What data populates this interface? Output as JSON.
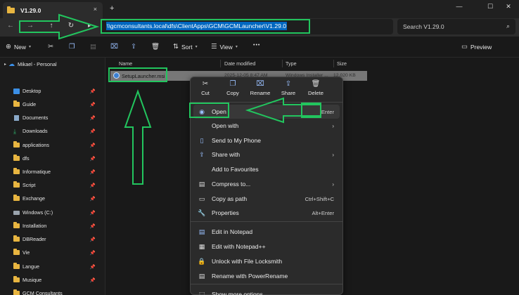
{
  "window": {
    "tab_title": "V1.29.0",
    "close_glyph": "×",
    "new_tab_glyph": "+",
    "minimize_glyph": "—",
    "maximize_glyph": "☐",
    "close_window_glyph": "✕"
  },
  "navigation": {
    "address": "\\\\gcmconsultants.local\\dfs\\ClientApps\\GCM\\GCMLauncher\\V1.29.0",
    "search_placeholder": "Search V1.29.0"
  },
  "toolbar": {
    "new_label": "New",
    "sort_label": "Sort",
    "view_label": "View",
    "more_label": "•••",
    "preview_label": "Preview"
  },
  "sidebar": {
    "personal": "Mikael - Personal",
    "items": [
      {
        "label": "Desktop",
        "icon": "desktop-icon"
      },
      {
        "label": "Guide",
        "icon": "folder-icon"
      },
      {
        "label": "Documents",
        "icon": "documents-icon"
      },
      {
        "label": "Downloads",
        "icon": "downloads-icon"
      },
      {
        "label": "applications",
        "icon": "folder-icon"
      },
      {
        "label": "dfs",
        "icon": "folder-icon"
      },
      {
        "label": "Informatique",
        "icon": "folder-icon"
      },
      {
        "label": "Script",
        "icon": "folder-icon"
      },
      {
        "label": "Exchange",
        "icon": "folder-icon"
      },
      {
        "label": "Windows (C:)",
        "icon": "drive-icon"
      },
      {
        "label": "Installation",
        "icon": "folder-icon"
      },
      {
        "label": "DBReader",
        "icon": "folder-icon"
      },
      {
        "label": "Vie",
        "icon": "folder-icon"
      },
      {
        "label": "Langue",
        "icon": "folder-icon"
      },
      {
        "label": "Musique",
        "icon": "folder-icon"
      },
      {
        "label": "GCM Consultants",
        "icon": "folder-icon"
      }
    ]
  },
  "columns": {
    "name": "Name",
    "date": "Date modified",
    "type": "Type",
    "size": "Size"
  },
  "file": {
    "name": "SetupLauncher.msi",
    "date": "2025-12-05 8:47 AM",
    "type": "Windows Installer ...",
    "size": "12,020 KB"
  },
  "context_menu": {
    "quick_actions": [
      "Cut",
      "Copy",
      "Rename",
      "Share",
      "Delete"
    ],
    "items": [
      {
        "label": "Open",
        "shortcut": "Enter",
        "icon": "installer-icon"
      },
      {
        "label": "Open with",
        "shortcut": "",
        "icon": "open-with-icon"
      },
      {
        "label": "Send to My Phone",
        "shortcut": "",
        "icon": "phone-icon"
      },
      {
        "label": "Share with",
        "shortcut": "",
        "icon": "share-with-icon"
      },
      {
        "label": "Add to Favourites",
        "shortcut": "",
        "icon": "star-icon"
      },
      {
        "label": "Compress to...",
        "shortcut": "",
        "icon": "zip-icon"
      },
      {
        "label": "Copy as path",
        "shortcut": "Ctrl+Shift+C",
        "icon": "path-icon"
      },
      {
        "label": "Properties",
        "shortcut": "Alt+Enter",
        "icon": "wrench-icon"
      },
      {
        "label": "Edit in Notepad",
        "shortcut": "",
        "icon": "notepad-icon"
      },
      {
        "label": "Edit with Notepad++",
        "shortcut": "",
        "icon": "notepadpp-icon"
      },
      {
        "label": "Unlock with File Locksmith",
        "shortcut": "",
        "icon": "lock-icon"
      },
      {
        "label": "Rename with PowerRename",
        "shortcut": "",
        "icon": "rename-icon"
      },
      {
        "label": "Show more options",
        "shortcut": "",
        "icon": "more-options-icon"
      }
    ]
  },
  "colors": {
    "accent": "#0067c0",
    "annotation": "#22c55e",
    "selection": "#777777"
  }
}
